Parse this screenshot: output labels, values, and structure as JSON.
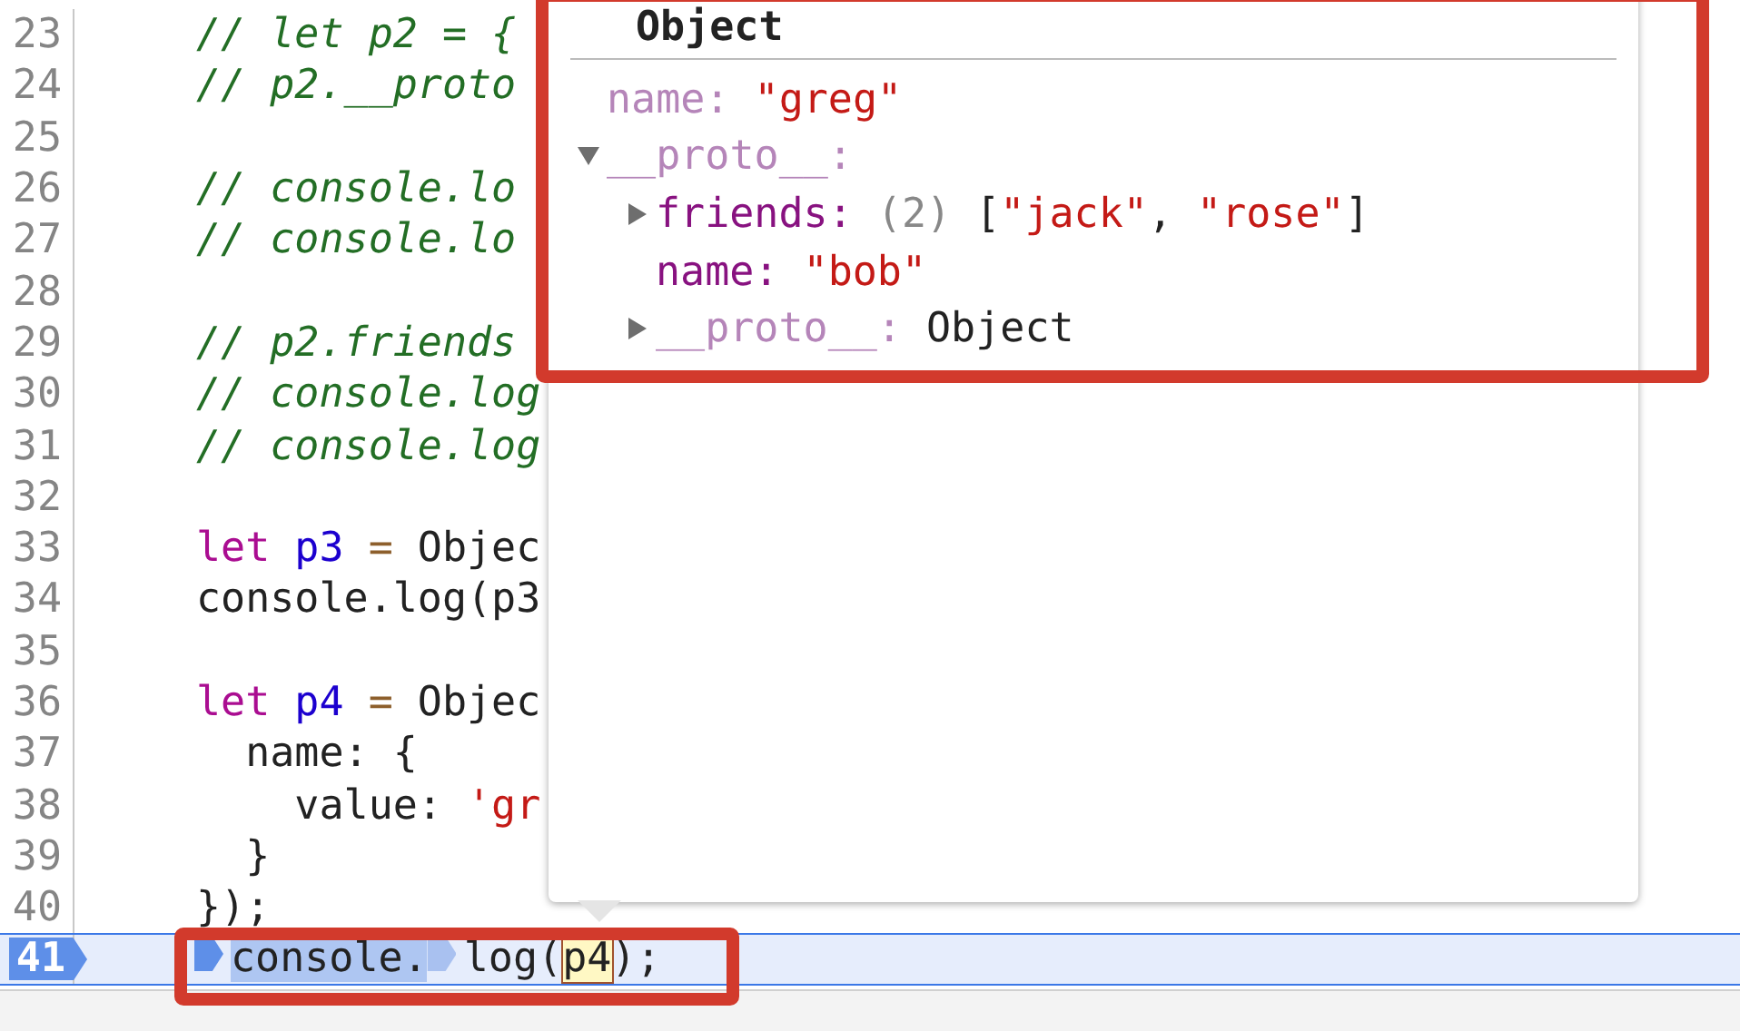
{
  "editor": {
    "lines": [
      {
        "number": "23",
        "current": false,
        "tokens": [
          {
            "text": "// let p2 = {",
            "kind": "comment"
          }
        ]
      },
      {
        "number": "24",
        "current": false,
        "tokens": [
          {
            "text": "// p2.__proto",
            "kind": "comment"
          }
        ]
      },
      {
        "number": "25",
        "current": false
      },
      {
        "number": "26",
        "current": false,
        "tokens": [
          {
            "text": "// console.lo",
            "kind": "comment"
          }
        ]
      },
      {
        "number": "27",
        "current": false,
        "tokens": [
          {
            "text": "// console.lo",
            "kind": "comment"
          }
        ]
      },
      {
        "number": "28",
        "current": false
      },
      {
        "number": "29",
        "current": false,
        "tokens": [
          {
            "text": "// p2.friends",
            "kind": "comment"
          }
        ]
      },
      {
        "number": "30",
        "current": false,
        "tokens": [
          {
            "text": "// console.log",
            "kind": "comment"
          }
        ]
      },
      {
        "number": "31",
        "current": false,
        "tokens": [
          {
            "text": "// console.log",
            "kind": "comment"
          }
        ]
      },
      {
        "number": "32",
        "current": false
      },
      {
        "number": "33",
        "current": false,
        "tokens": [
          {
            "text": "let",
            "kind": "keyword"
          },
          {
            "text": " p3",
            "kind": "definition"
          },
          {
            "text": " =",
            "kind": "operator"
          },
          {
            "text": " Objec",
            "kind": "plain"
          }
        ]
      },
      {
        "number": "34",
        "current": false,
        "tokens": [
          {
            "text": "console.log(p3",
            "kind": "plain"
          }
        ]
      },
      {
        "number": "35",
        "current": false
      },
      {
        "number": "36",
        "current": false,
        "tokens": [
          {
            "text": "let",
            "kind": "keyword"
          },
          {
            "text": " p4",
            "kind": "definition"
          },
          {
            "text": " =",
            "kind": "operator"
          },
          {
            "text": " Objec",
            "kind": "plain"
          }
        ]
      },
      {
        "number": "37",
        "current": false,
        "tokens": [
          {
            "text": "  name: {",
            "kind": "plain"
          }
        ]
      },
      {
        "number": "38",
        "current": false,
        "tokens": [
          {
            "text": "    value: ",
            "kind": "plain"
          },
          {
            "text": "'gr",
            "kind": "string"
          }
        ]
      },
      {
        "number": "39",
        "current": false,
        "tokens": [
          {
            "text": "  }",
            "kind": "plain"
          }
        ]
      },
      {
        "number": "40",
        "current": false,
        "tokens": [
          {
            "text": "});",
            "kind": "plain"
          }
        ]
      },
      {
        "number": "41",
        "current": true,
        "tokens": [
          {
            "text": "console.",
            "kind": "plain",
            "step": true,
            "selected": true,
            "hovered": false
          },
          {
            "text": "log(",
            "kind": "plain",
            "step": true,
            "selected": false,
            "hovered": false
          },
          {
            "text": "p4",
            "kind": "plain",
            "step": false,
            "selected": false,
            "hovered": true
          },
          {
            "text": ");",
            "kind": "plain",
            "step": false,
            "selected": false,
            "hovered": false
          }
        ]
      }
    ]
  },
  "popover": {
    "title": "Object",
    "properties": [
      {
        "kind": "leaf",
        "key": "name:",
        "enumerable": false,
        "value": [
          {
            "text": " \"greg\"",
            "kind": "string"
          }
        ]
      },
      {
        "kind": "expandable",
        "key": "__proto__:",
        "enumerable": false,
        "expanded": true,
        "children": [
          {
            "kind": "expandable",
            "key": "friends:",
            "enumerable": true,
            "expanded": false,
            "value": [
              {
                "text": " (2)",
                "kind": "count"
              },
              {
                "text": " [",
                "kind": "plain"
              },
              {
                "text": "\"jack\"",
                "kind": "string"
              },
              {
                "text": ", ",
                "kind": "plain"
              },
              {
                "text": "\"rose\"",
                "kind": "string"
              },
              {
                "text": "]",
                "kind": "plain"
              }
            ]
          },
          {
            "kind": "leaf",
            "key": "name:",
            "enumerable": true,
            "value": [
              {
                "text": " \"bob\"",
                "kind": "string"
              }
            ]
          },
          {
            "kind": "expandable",
            "key": "__proto__:",
            "enumerable": false,
            "expanded": false,
            "value": [
              {
                "text": " Object",
                "kind": "plain"
              }
            ]
          }
        ]
      }
    ]
  }
}
